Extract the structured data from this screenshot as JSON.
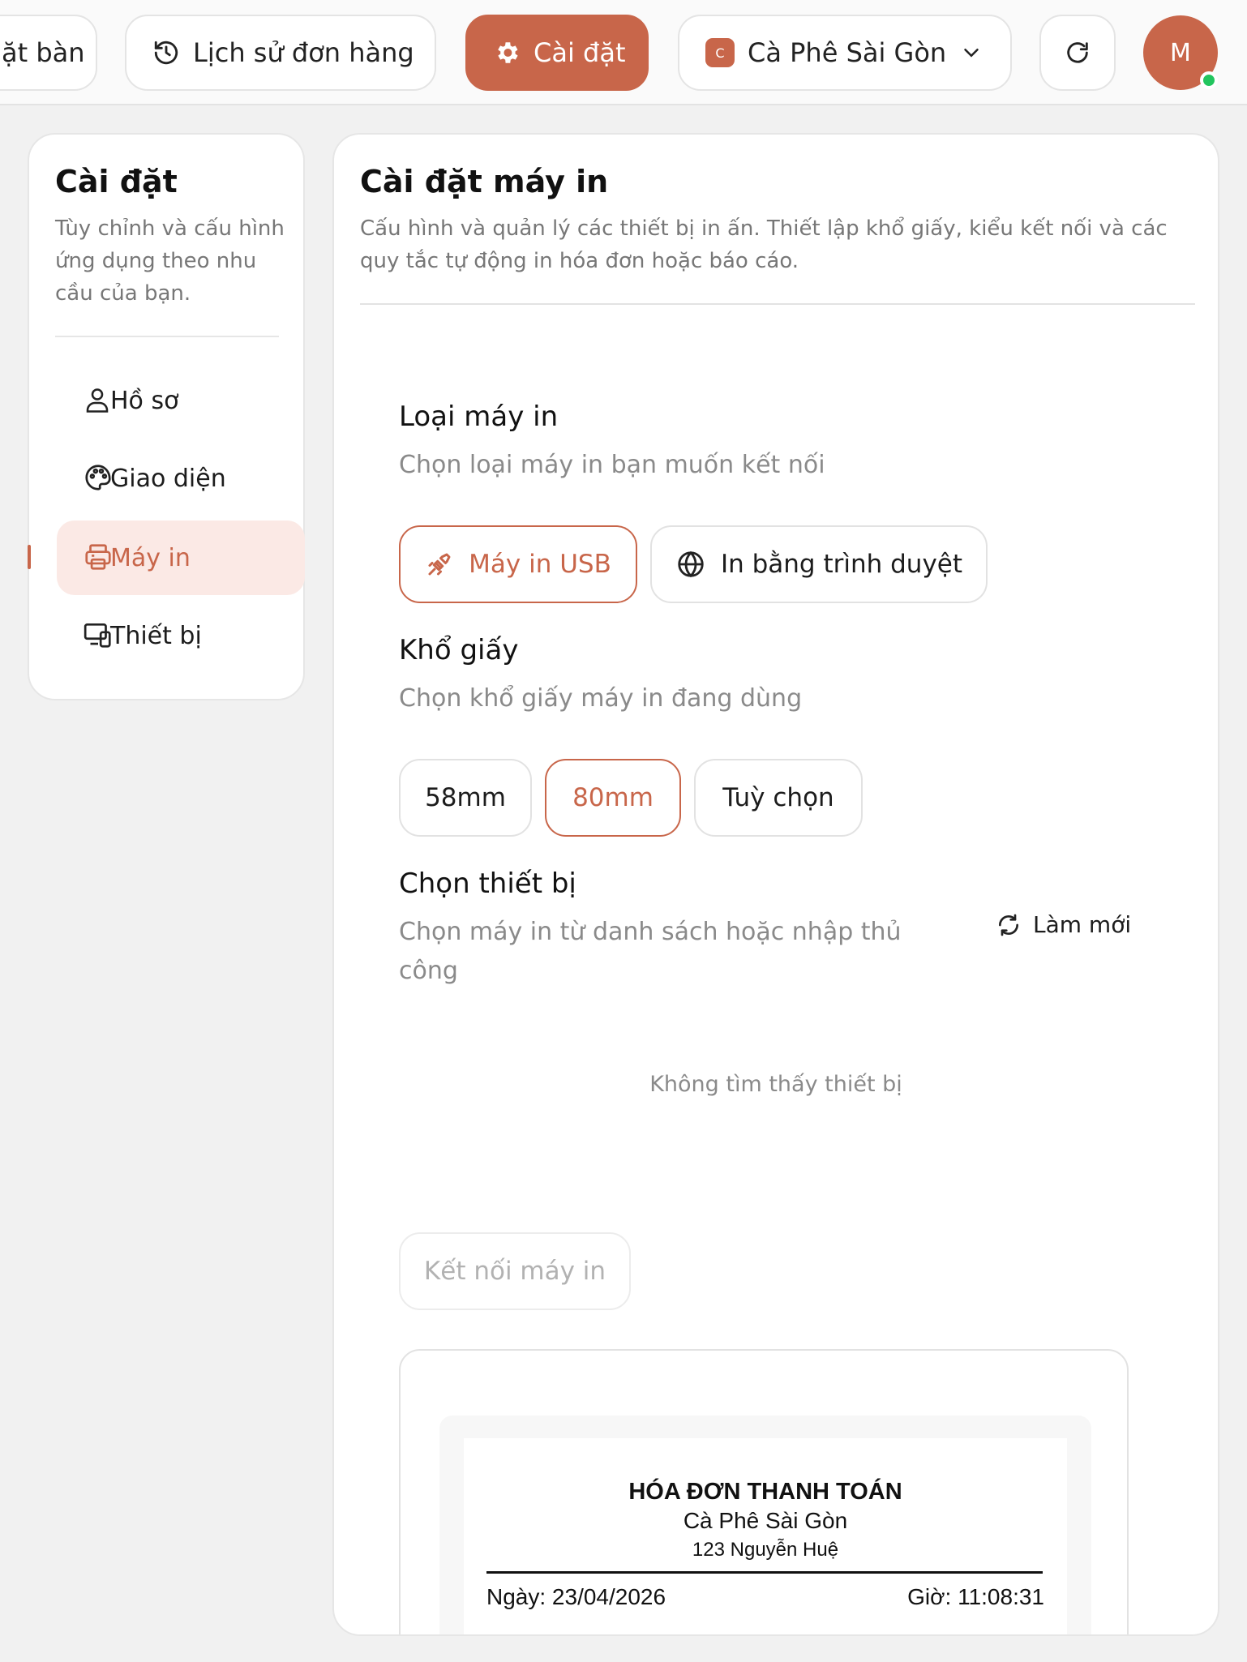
{
  "topbar": {
    "tables_partial": "ặt bàn",
    "order_history": "Lịch sử đơn hàng",
    "settings": "Cài đặt",
    "store_badge": "C",
    "store_name": "Cà Phê Sài Gòn",
    "avatar_initial": "M"
  },
  "sidebar": {
    "title": "Cài đặt",
    "description": "Tùy chỉnh và cấu hình ứng dụng theo nhu cầu của bạn.",
    "items": [
      {
        "label": "Hồ sơ",
        "icon": "user-icon"
      },
      {
        "label": "Giao diện",
        "icon": "palette-icon"
      },
      {
        "label": "Máy in",
        "icon": "printer-icon",
        "active": true
      },
      {
        "label": "Thiết bị",
        "icon": "devices-icon"
      }
    ]
  },
  "panel": {
    "title": "Cài đặt máy in",
    "description": "Cấu hình và quản lý các thiết bị in ấn. Thiết lập khổ giấy, kiểu kết nối và các quy tắc tự động in hóa đơn hoặc báo cáo.",
    "printer_type": {
      "title": "Loại máy in",
      "subtitle": "Chọn loại máy in bạn muốn kết nối",
      "options": [
        "Máy in USB",
        "In bằng trình duyệt"
      ],
      "selected": "Máy in USB"
    },
    "paper": {
      "title": "Khổ giấy",
      "subtitle": "Chọn khổ giấy máy in đang dùng",
      "options": [
        "58mm",
        "80mm",
        "Tuỳ chọn"
      ],
      "selected": "80mm"
    },
    "device": {
      "title": "Chọn thiết bị",
      "subtitle": "Chọn máy in từ danh sách hoặc nhập thủ công",
      "refresh": "Làm mới",
      "empty": "Không tìm thấy thiết bị"
    },
    "connect_button": "Kết nối máy in",
    "receipt": {
      "title": "HÓA ĐƠN THANH TOÁN",
      "store": "Cà Phê Sài Gòn",
      "address": "123 Nguyễn Huệ",
      "date": "Ngày: 23/04/2026",
      "time": "Giờ: 11:08:31"
    }
  },
  "colors": {
    "accent": "#c8664a",
    "accent_soft": "#fbe9e5",
    "online": "#22c55e"
  }
}
